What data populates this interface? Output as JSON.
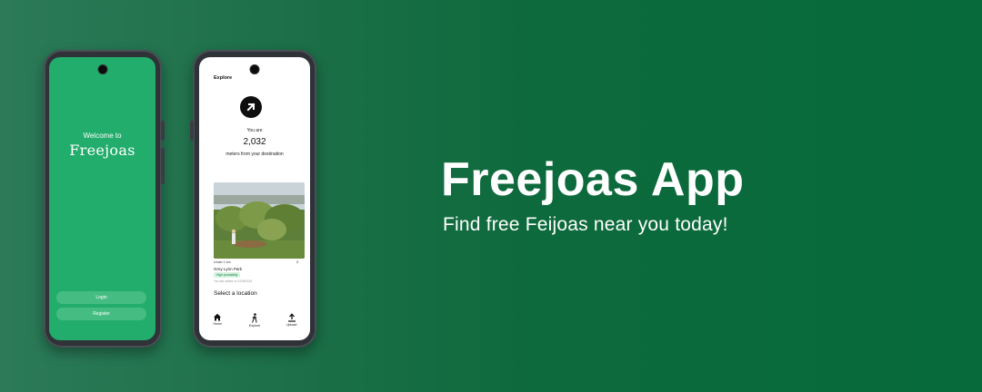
{
  "banner": {
    "title": "Freejoas App",
    "subtitle": "Find free Feijoas near you today!"
  },
  "colors": {
    "brand_green": "#22ad6c",
    "button_green": "#45bd82",
    "background_dark": "#066a3a"
  },
  "welcome_screen": {
    "welcome_label": "Welcome to",
    "brand_name": "Freejoas",
    "login_label": "Login",
    "register_label": "Register"
  },
  "explore_screen": {
    "title": "Explore",
    "direction_icon": "arrow-up-right-icon",
    "you_are_label": "You are",
    "distance_value": "2,032",
    "distance_caption": "meters from your destination",
    "location": {
      "distance_label": "Under 1 km",
      "count": "2",
      "name": "Grey Lynn Park",
      "probability_badge": "High probability",
      "last_found": "You last visited on 22/06/2024"
    },
    "select_location_label": "Select a location",
    "nav": [
      {
        "label": "Home",
        "icon": "home-icon"
      },
      {
        "label": "Explore",
        "icon": "walking-person-icon"
      },
      {
        "label": "Upload",
        "icon": "upload-icon"
      }
    ]
  }
}
